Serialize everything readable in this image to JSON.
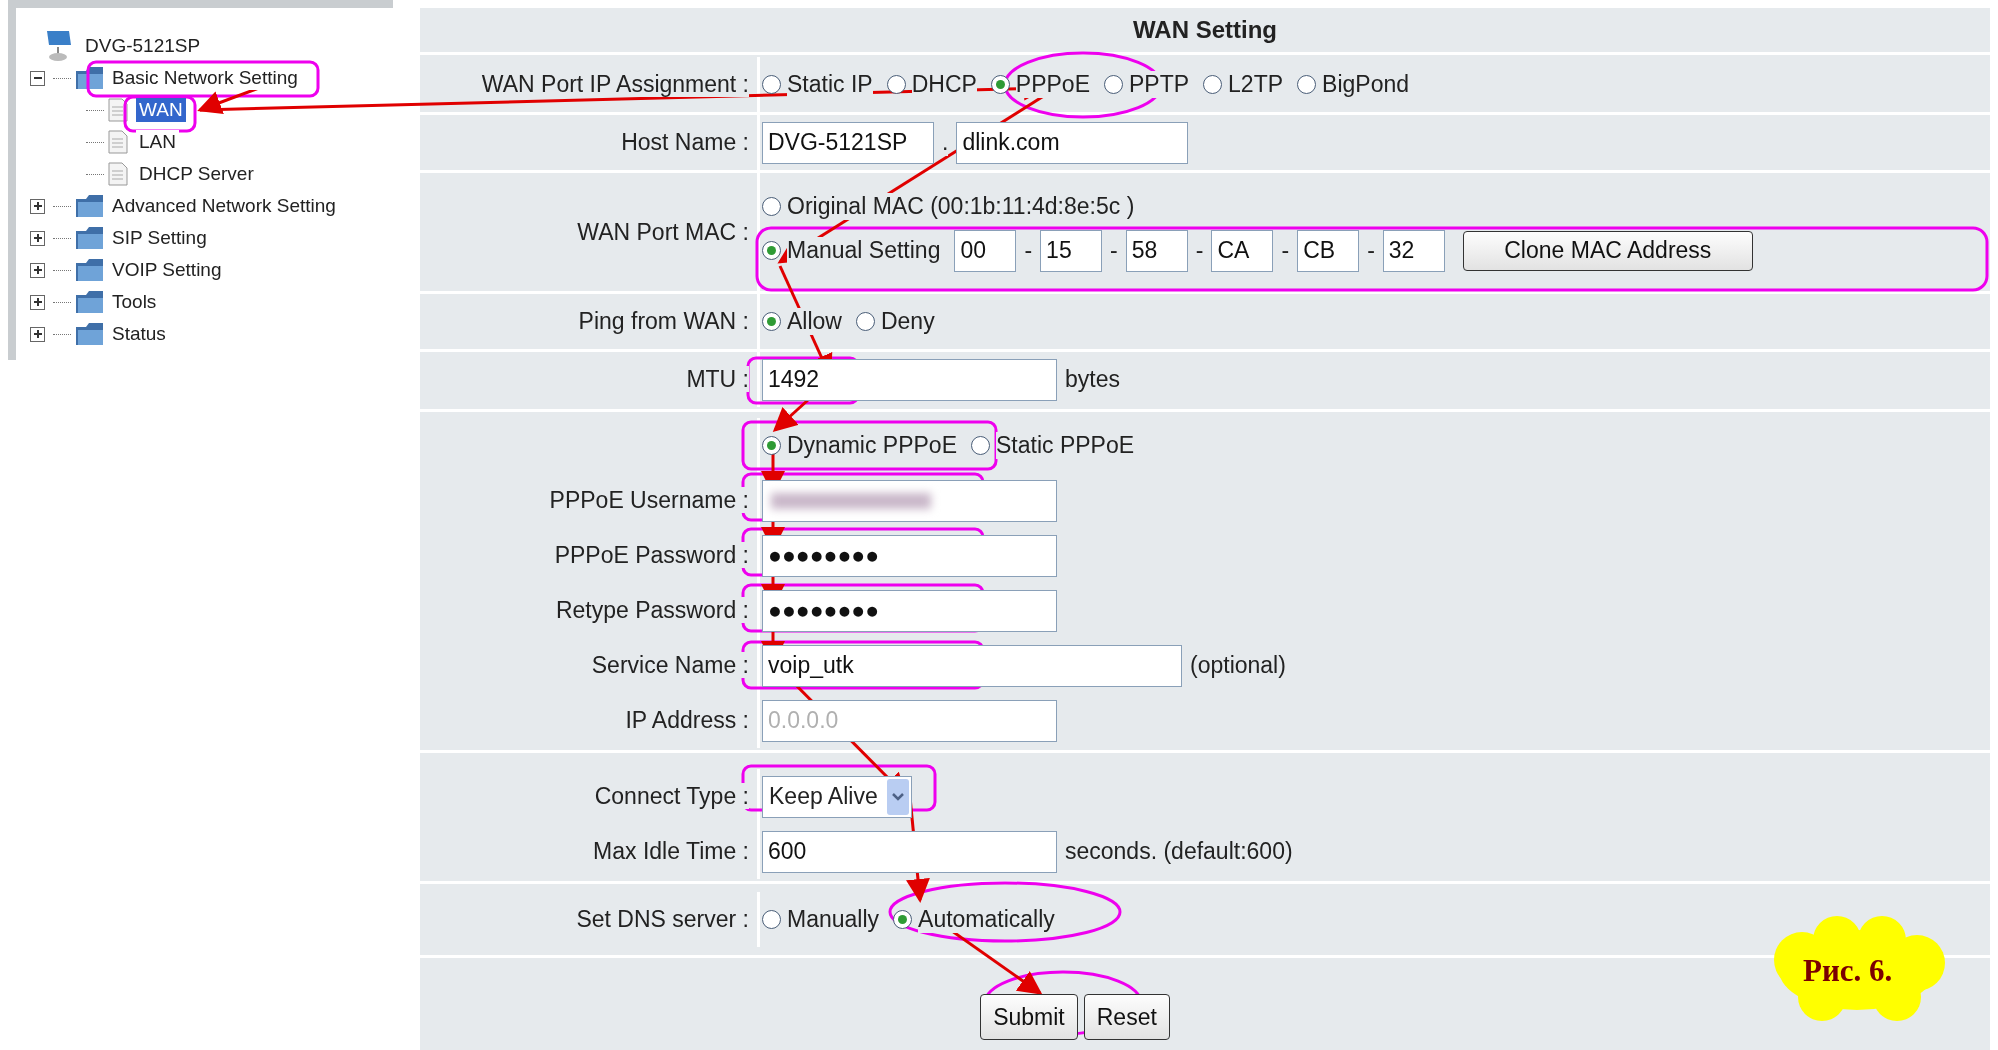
{
  "tree": {
    "root": "DVG-5121SP",
    "items": [
      {
        "label": "Basic Network Setting",
        "expanded": true,
        "selected": false,
        "children": [
          {
            "label": "WAN",
            "selected": true
          },
          {
            "label": "LAN",
            "selected": false
          },
          {
            "label": "DHCP Server",
            "selected": false
          }
        ]
      },
      {
        "label": "Advanced Network Setting",
        "expanded": false,
        "selected": false
      },
      {
        "label": "SIP Setting",
        "expanded": false,
        "selected": false
      },
      {
        "label": "VOIP Setting",
        "expanded": false,
        "selected": false
      },
      {
        "label": "Tools",
        "expanded": false,
        "selected": false
      },
      {
        "label": "Status",
        "expanded": false,
        "selected": false
      }
    ]
  },
  "form": {
    "title": "WAN Setting",
    "sections": [
      {
        "rows": [
          {
            "kind": "radios",
            "label": "WAN Port IP Assignment :",
            "options": [
              {
                "label": "Static IP",
                "selected": false
              },
              {
                "label": "DHCP",
                "selected": false
              },
              {
                "label": "PPPoE",
                "selected": true
              },
              {
                "label": "PPTP",
                "selected": false
              },
              {
                "label": "L2TP",
                "selected": false
              },
              {
                "label": "BigPond",
                "selected": false
              }
            ]
          },
          {
            "kind": "host",
            "label": "Host Name :",
            "fields": [
              "DVG-5121SP",
              "dlink.com"
            ],
            "separator": "."
          },
          {
            "kind": "mac",
            "label": "WAN Port MAC :",
            "options": [
              {
                "label": "Original MAC (00:1b:11:4d:8e:5c )",
                "selected": false
              },
              {
                "label": "Manual Setting",
                "selected": true
              }
            ],
            "octets": [
              "00",
              "15",
              "58",
              "CA",
              "CB",
              "32"
            ],
            "separators": [
              "-",
              "-",
              "-",
              "-",
              "-"
            ],
            "button": "Clone MAC Address"
          },
          {
            "kind": "radios",
            "label": "Ping from WAN :",
            "options": [
              {
                "label": "Allow",
                "selected": true
              },
              {
                "label": "Deny",
                "selected": false
              }
            ]
          },
          {
            "kind": "input",
            "label": "MTU :",
            "value": "1492",
            "suffix": "bytes"
          }
        ]
      },
      {
        "rows": [
          {
            "kind": "radios",
            "options": [
              {
                "label": "Dynamic PPPoE",
                "selected": true
              },
              {
                "label": "Static PPPoE",
                "selected": false
              }
            ]
          },
          {
            "kind": "blurred",
            "label": "PPPoE Username :"
          },
          {
            "kind": "input",
            "label": "PPPoE Password :",
            "value": "●●●●●●●●"
          },
          {
            "kind": "input",
            "label": "Retype Password :",
            "value": "●●●●●●●●"
          },
          {
            "kind": "wide",
            "label": "Service Name :",
            "value": "voip_utk",
            "suffix": "(optional)"
          },
          {
            "kind": "input",
            "label": "IP Address :",
            "value": "0.0.0.0",
            "disabled": true
          }
        ]
      },
      {
        "rows": [
          {
            "kind": "select",
            "label": "Connect Type :",
            "value": "Keep Alive"
          },
          {
            "kind": "input",
            "label": "Max Idle Time :",
            "value": "600",
            "suffix": "seconds. (default:600)"
          }
        ]
      },
      {
        "rows": [
          {
            "kind": "radios",
            "label": "Set DNS server :",
            "options": [
              {
                "label": "Manually",
                "selected": false
              },
              {
                "label": "Automatically",
                "selected": true
              }
            ]
          }
        ]
      }
    ],
    "buttons": [
      "Submit",
      "Reset"
    ]
  },
  "figure_label": "Рис. 6."
}
